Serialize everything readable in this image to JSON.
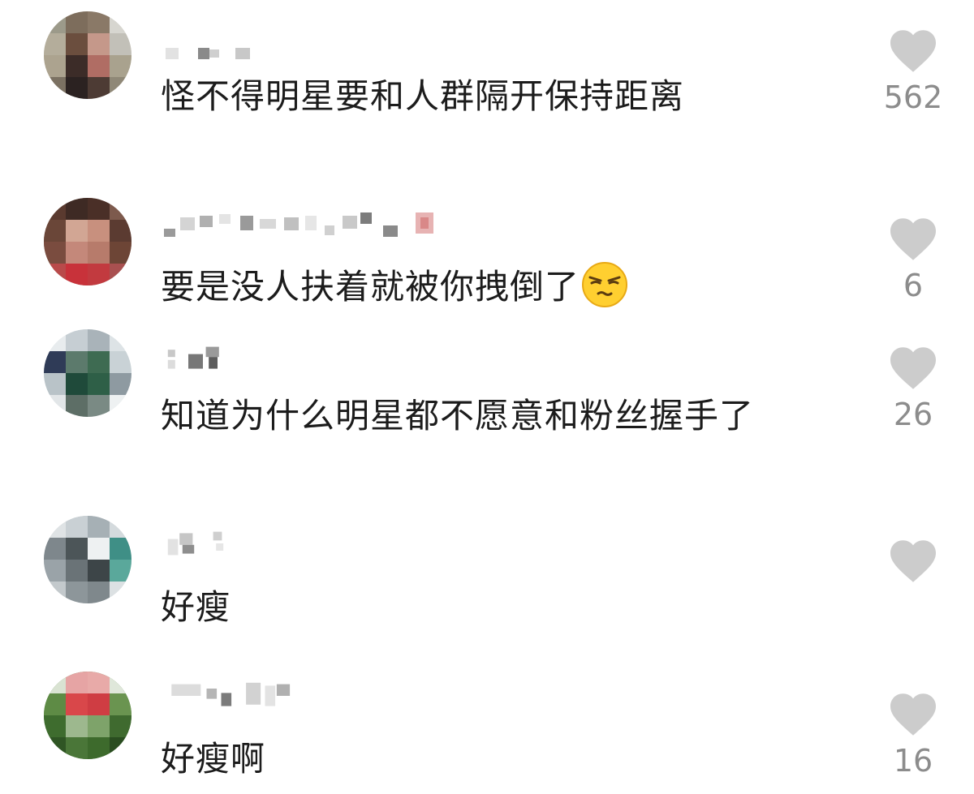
{
  "colors": {
    "text": "#1c1c1c",
    "count": "#8c8c8c",
    "heart": "#cccccc"
  },
  "icons": {
    "like": "heart-icon",
    "emoji": "smirk-face-emoji-icon"
  },
  "comments": [
    {
      "text": "怪不得明星要和人群隔开保持距离",
      "likes": "562"
    },
    {
      "text": "要是没人扶着就被你拽倒了",
      "likes": "6"
    },
    {
      "text": "知道为什么明星都不愿意和粉丝握手了",
      "likes": "26"
    },
    {
      "text": "好瘦",
      "likes": ""
    },
    {
      "text": "好瘦啊",
      "likes": "16"
    }
  ]
}
